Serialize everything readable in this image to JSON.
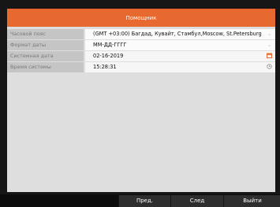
{
  "dialog": {
    "title": "Помощник"
  },
  "rows": [
    {
      "label": "Часовой пояс",
      "value": "(GMT +03:00) Багдад, Кувайт, Стамбул,Moscow, St.Petersburg",
      "icon": "chevron-down-icon"
    },
    {
      "label": "Формат даты",
      "value": "ММ-ДД-ГГГГ",
      "icon": "chevron-down-icon"
    },
    {
      "label": "Системная дата",
      "value": "02-16-2019",
      "icon": "calendar-icon"
    },
    {
      "label": "Время системы",
      "value": "15:28:31",
      "icon": "clock-icon"
    }
  ],
  "footer": {
    "prev_label": "Пред.",
    "next_label": "След",
    "exit_label": "Выйти"
  },
  "colors": {
    "accent": "#e8692f",
    "dialog_bg": "#dedede",
    "label_bg": "#c5c5c5",
    "button_bg": "#2e2e2e"
  }
}
